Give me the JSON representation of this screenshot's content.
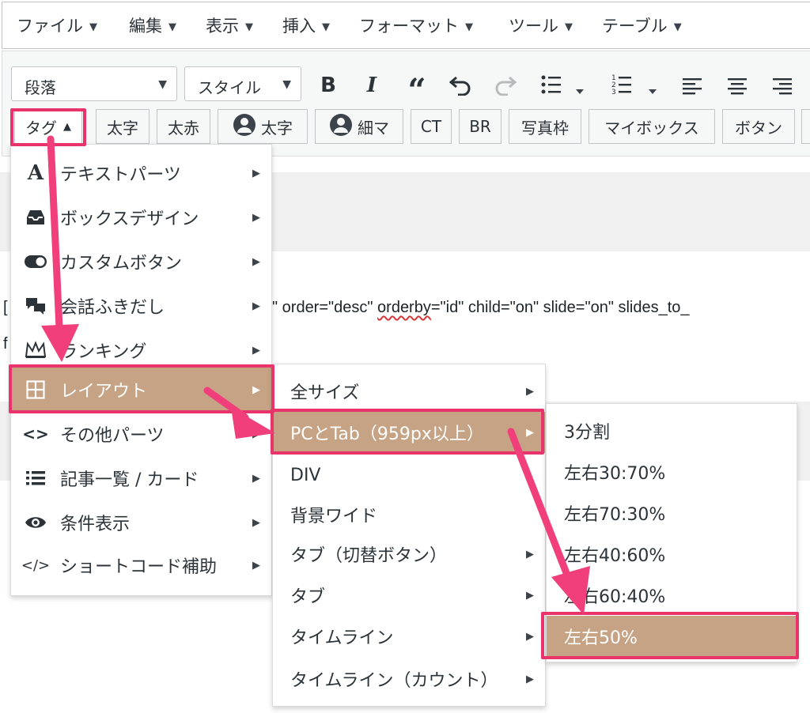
{
  "menubar": {
    "items": [
      "ファイル",
      "編集",
      "表示",
      "挿入",
      "フォーマット",
      "ツール",
      "テーブル"
    ]
  },
  "toolbar": {
    "paragraph_select": "段落",
    "style_select": "スタイル",
    "icons": [
      "bold-icon",
      "italic-icon",
      "blockquote-icon",
      "undo-icon",
      "redo-icon",
      "bullet-list-icon",
      "numbered-list-icon",
      "align-left-icon",
      "align-center-icon",
      "align-right-icon"
    ],
    "bold_glyph": "B",
    "italic_glyph": "I",
    "quote_glyph": "“",
    "tag_button": "タグ",
    "quick_buttons": [
      "太字",
      "太赤",
      "太字",
      "細マ",
      "CT",
      "BR",
      "写真枠",
      "マイボックス",
      "ボタン"
    ]
  },
  "content": {
    "line1_prefix": "[",
    "line1_a": "\" order=\"desc\" ",
    "line1_squiggle": "orderby",
    "line1_b": "=\"id\" child=\"on\" slide=\"on\" slides_to_",
    "line2_prefix": "f"
  },
  "menu_level1": {
    "items": [
      {
        "icon": "text-a-icon",
        "label": "テキストパーツ",
        "has_sub": true
      },
      {
        "icon": "inbox-icon",
        "label": "ボックスデザイン",
        "has_sub": true
      },
      {
        "icon": "toggle-icon",
        "label": "カスタムボタン",
        "has_sub": true
      },
      {
        "icon": "chat-bubbles-icon",
        "label": "会話ふきだし",
        "has_sub": true
      },
      {
        "icon": "crown-icon",
        "label": "ランキング",
        "has_sub": true
      },
      {
        "icon": "layout-grid-icon",
        "label": "レイアウト",
        "has_sub": true,
        "active": true
      },
      {
        "icon": "code-chevrons-icon",
        "label": "その他パーツ",
        "has_sub": true
      },
      {
        "icon": "list-icon",
        "label": "記事一覧 / カード",
        "has_sub": true
      },
      {
        "icon": "eye-icon",
        "label": "条件表示",
        "has_sub": true
      },
      {
        "icon": "code-slash-icon",
        "label": "ショートコード補助",
        "has_sub": true
      }
    ]
  },
  "menu_level2": {
    "items": [
      {
        "label": "全サイズ",
        "has_sub": true
      },
      {
        "label": "PCとTab（959px以上）",
        "has_sub": true,
        "active": true
      },
      {
        "label": "DIV",
        "has_sub": false
      },
      {
        "label": "背景ワイド",
        "has_sub": false
      },
      {
        "label": "タブ（切替ボタン）",
        "has_sub": true
      },
      {
        "label": "タブ",
        "has_sub": true
      },
      {
        "label": "タイムライン",
        "has_sub": true
      },
      {
        "label": "タイムライン（カウント）",
        "has_sub": true
      }
    ]
  },
  "menu_level3": {
    "items": [
      {
        "label": "3分割"
      },
      {
        "label": "左右30:70%"
      },
      {
        "label": "左右70:30%"
      },
      {
        "label": "左右40:60%"
      },
      {
        "label": "左右60:40%"
      },
      {
        "label": "左右50%",
        "active": true
      }
    ]
  },
  "colors": {
    "active_bg": "#c5a384",
    "highlight": "#e8336b",
    "arrow": "#f03f7a"
  }
}
